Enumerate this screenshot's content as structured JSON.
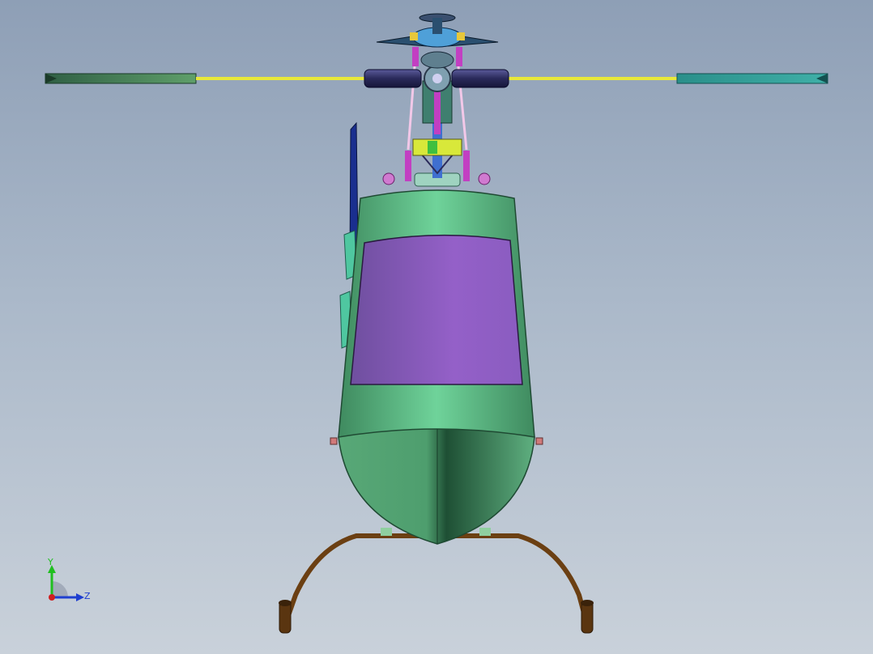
{
  "viewport": {
    "background_top": "#8e9fb6",
    "background_bottom": "#c9d1da"
  },
  "model": {
    "colors": {
      "fuselage": "#5fbf8a",
      "fuselage_dark": "#1f5c3c",
      "canopy": "#8a5cc4",
      "blade_root": "#e8e83a",
      "blade_tip_left": "#3f7a5a",
      "blade_tip_right": "#2f8f8f",
      "rotor_hub": "#2a2a5a",
      "linkage": "#c23fc2",
      "skid": "#6b3f12",
      "tail_fin": "#1a2f8f"
    }
  },
  "triad": {
    "y_label": "Y",
    "z_label": "Z",
    "y_color": "#1fbf1f",
    "z_color": "#1f3fd0",
    "x_color": "#d01f1f"
  }
}
